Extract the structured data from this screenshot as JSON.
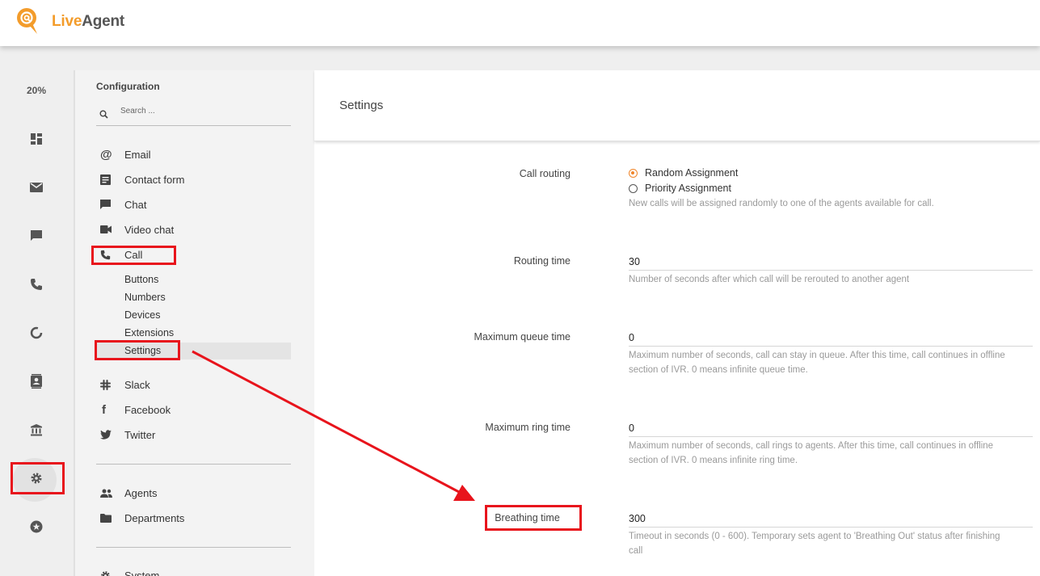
{
  "brand": {
    "live": "Live",
    "agent": "Agent"
  },
  "rail": {
    "percent": "20%",
    "icons": [
      "dashboard-icon",
      "mail-icon",
      "chat-icon",
      "phone-icon",
      "reports-icon",
      "contacts-icon",
      "knowledgebase-icon",
      "gear-icon",
      "star-icon"
    ]
  },
  "config": {
    "title": "Configuration",
    "search_placeholder": "Search ...",
    "items": [
      {
        "label": "Email",
        "icon": "at-icon"
      },
      {
        "label": "Contact form",
        "icon": "form-icon"
      },
      {
        "label": "Chat",
        "icon": "chat-icon"
      },
      {
        "label": "Video chat",
        "icon": "video-icon"
      },
      {
        "label": "Call",
        "icon": "phone-icon"
      }
    ],
    "call_subitems": [
      "Buttons",
      "Numbers",
      "Devices",
      "Extensions",
      "Settings"
    ],
    "integrations": [
      {
        "label": "Slack",
        "icon": "slack-icon"
      },
      {
        "label": "Facebook",
        "icon": "facebook-icon"
      },
      {
        "label": "Twitter",
        "icon": "twitter-icon"
      }
    ],
    "people": [
      {
        "label": "Agents",
        "icon": "agents-icon"
      },
      {
        "label": "Departments",
        "icon": "folder-icon"
      }
    ],
    "system_label": "System"
  },
  "settings": {
    "title": "Settings",
    "call_routing": {
      "label": "Call routing",
      "options": [
        "Random Assignment",
        "Priority Assignment"
      ],
      "selected": "Random Assignment",
      "help": "New calls will be assigned randomly to one of the agents available for call."
    },
    "routing_time": {
      "label": "Routing time",
      "value": "30",
      "help": "Number of seconds after which call will be rerouted to another agent"
    },
    "max_queue_time": {
      "label": "Maximum queue time",
      "value": "0",
      "help_line1": "Maximum number of seconds, call can stay in queue. After this time, call continues in offline",
      "help_line2": "section of IVR. 0 means infinite queue time."
    },
    "max_ring_time": {
      "label": "Maximum ring time",
      "value": "0",
      "help_line1": "Maximum number of seconds, call rings to agents. After this time, call continues in offline",
      "help_line2": "section of IVR. 0 means infinite ring time."
    },
    "breathing_time": {
      "label": "Breathing time",
      "value": "300",
      "help_line1": "Timeout in seconds (0 - 600). Temporary sets agent to 'Breathing Out' status after finishing",
      "help_line2": "call"
    }
  },
  "colors": {
    "accent": "#f0862c",
    "highlight": "#e8141c"
  }
}
